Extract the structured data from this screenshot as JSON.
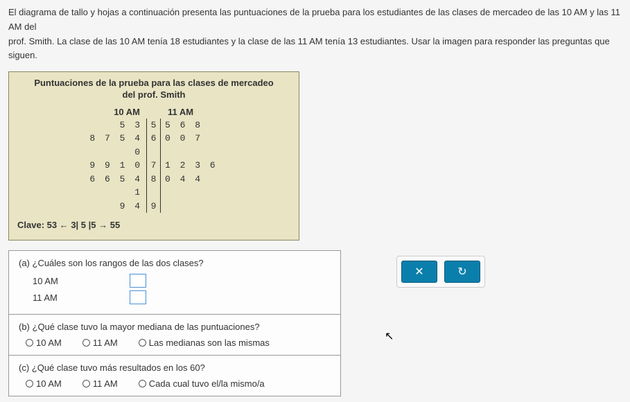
{
  "intro_line1": "El diagrama de tallo y hojas a continuación presenta las puntuaciones de la prueba para los estudiantes de las clases de mercadeo de las 10 AM y las 11 AM del",
  "intro_line2": "prof. Smith. La clase de las 10 AM tenía 18 estudiantes y la clase de las 11 AM tenía 13 estudiantes. Usar la imagen para responder las preguntas que siguen.",
  "stemleaf": {
    "title_line1": "Puntuaciones de la prueba para las clases de mercadeo",
    "title_line2": "del prof. Smith",
    "header_left": "10 AM",
    "header_right": "11 AM",
    "rows": [
      {
        "left": "5 3",
        "stem": "5",
        "right": "5 6 8"
      },
      {
        "left": "8 7 5 4 0",
        "stem": "6",
        "right": "0 0 7"
      },
      {
        "left": "9 9 1 0",
        "stem": "7",
        "right": "1 2 3 6"
      },
      {
        "left": "6 6 5 4 1",
        "stem": "8",
        "right": "0 4 4"
      },
      {
        "left": "9 4",
        "stem": "9",
        "right": ""
      }
    ],
    "clave": "Clave:  53 ← 3| 5 |5 → 55"
  },
  "questions": {
    "a": {
      "text": "(a) ¿Cuáles son los rangos de las dos clases?",
      "row1_label": "10 AM",
      "row2_label": "11 AM"
    },
    "b": {
      "text": "(b) ¿Qué clase tuvo la mayor mediana de las puntuaciones?",
      "opt1": "10 AM",
      "opt2": "11 AM",
      "opt3": "Las medianas son las mismas"
    },
    "c": {
      "text": "(c) ¿Qué clase tuvo más resultados en los 60?",
      "opt1": "10 AM",
      "opt2": "11 AM",
      "opt3": "Cada cual tuvo el/la mismo/a"
    }
  },
  "buttons": {
    "close": "✕",
    "reset": "↻"
  },
  "chart_data": {
    "type": "table",
    "title": "Puntuaciones de la prueba para las clases de mercadeo del prof. Smith",
    "description": "Back-to-back stem-and-leaf plot",
    "key": "3|5|5 means 53 (left) and 55 (right)",
    "class_10AM_scores": [
      53,
      55,
      60,
      64,
      65,
      67,
      68,
      70,
      71,
      79,
      79,
      81,
      84,
      85,
      86,
      86,
      94,
      99
    ],
    "class_11AM_scores": [
      55,
      56,
      58,
      60,
      60,
      67,
      71,
      72,
      73,
      76,
      80,
      84,
      84
    ],
    "stems": [
      5,
      6,
      7,
      8,
      9
    ],
    "leaves_10AM": [
      [
        5,
        3
      ],
      [
        8,
        7,
        5,
        4,
        0
      ],
      [
        9,
        9,
        1,
        0
      ],
      [
        6,
        6,
        5,
        4,
        1
      ],
      [
        9,
        4
      ]
    ],
    "leaves_11AM": [
      [
        5,
        6,
        8
      ],
      [
        0,
        0,
        7
      ],
      [
        1,
        2,
        3,
        6
      ],
      [
        0,
        4,
        4
      ],
      []
    ]
  }
}
